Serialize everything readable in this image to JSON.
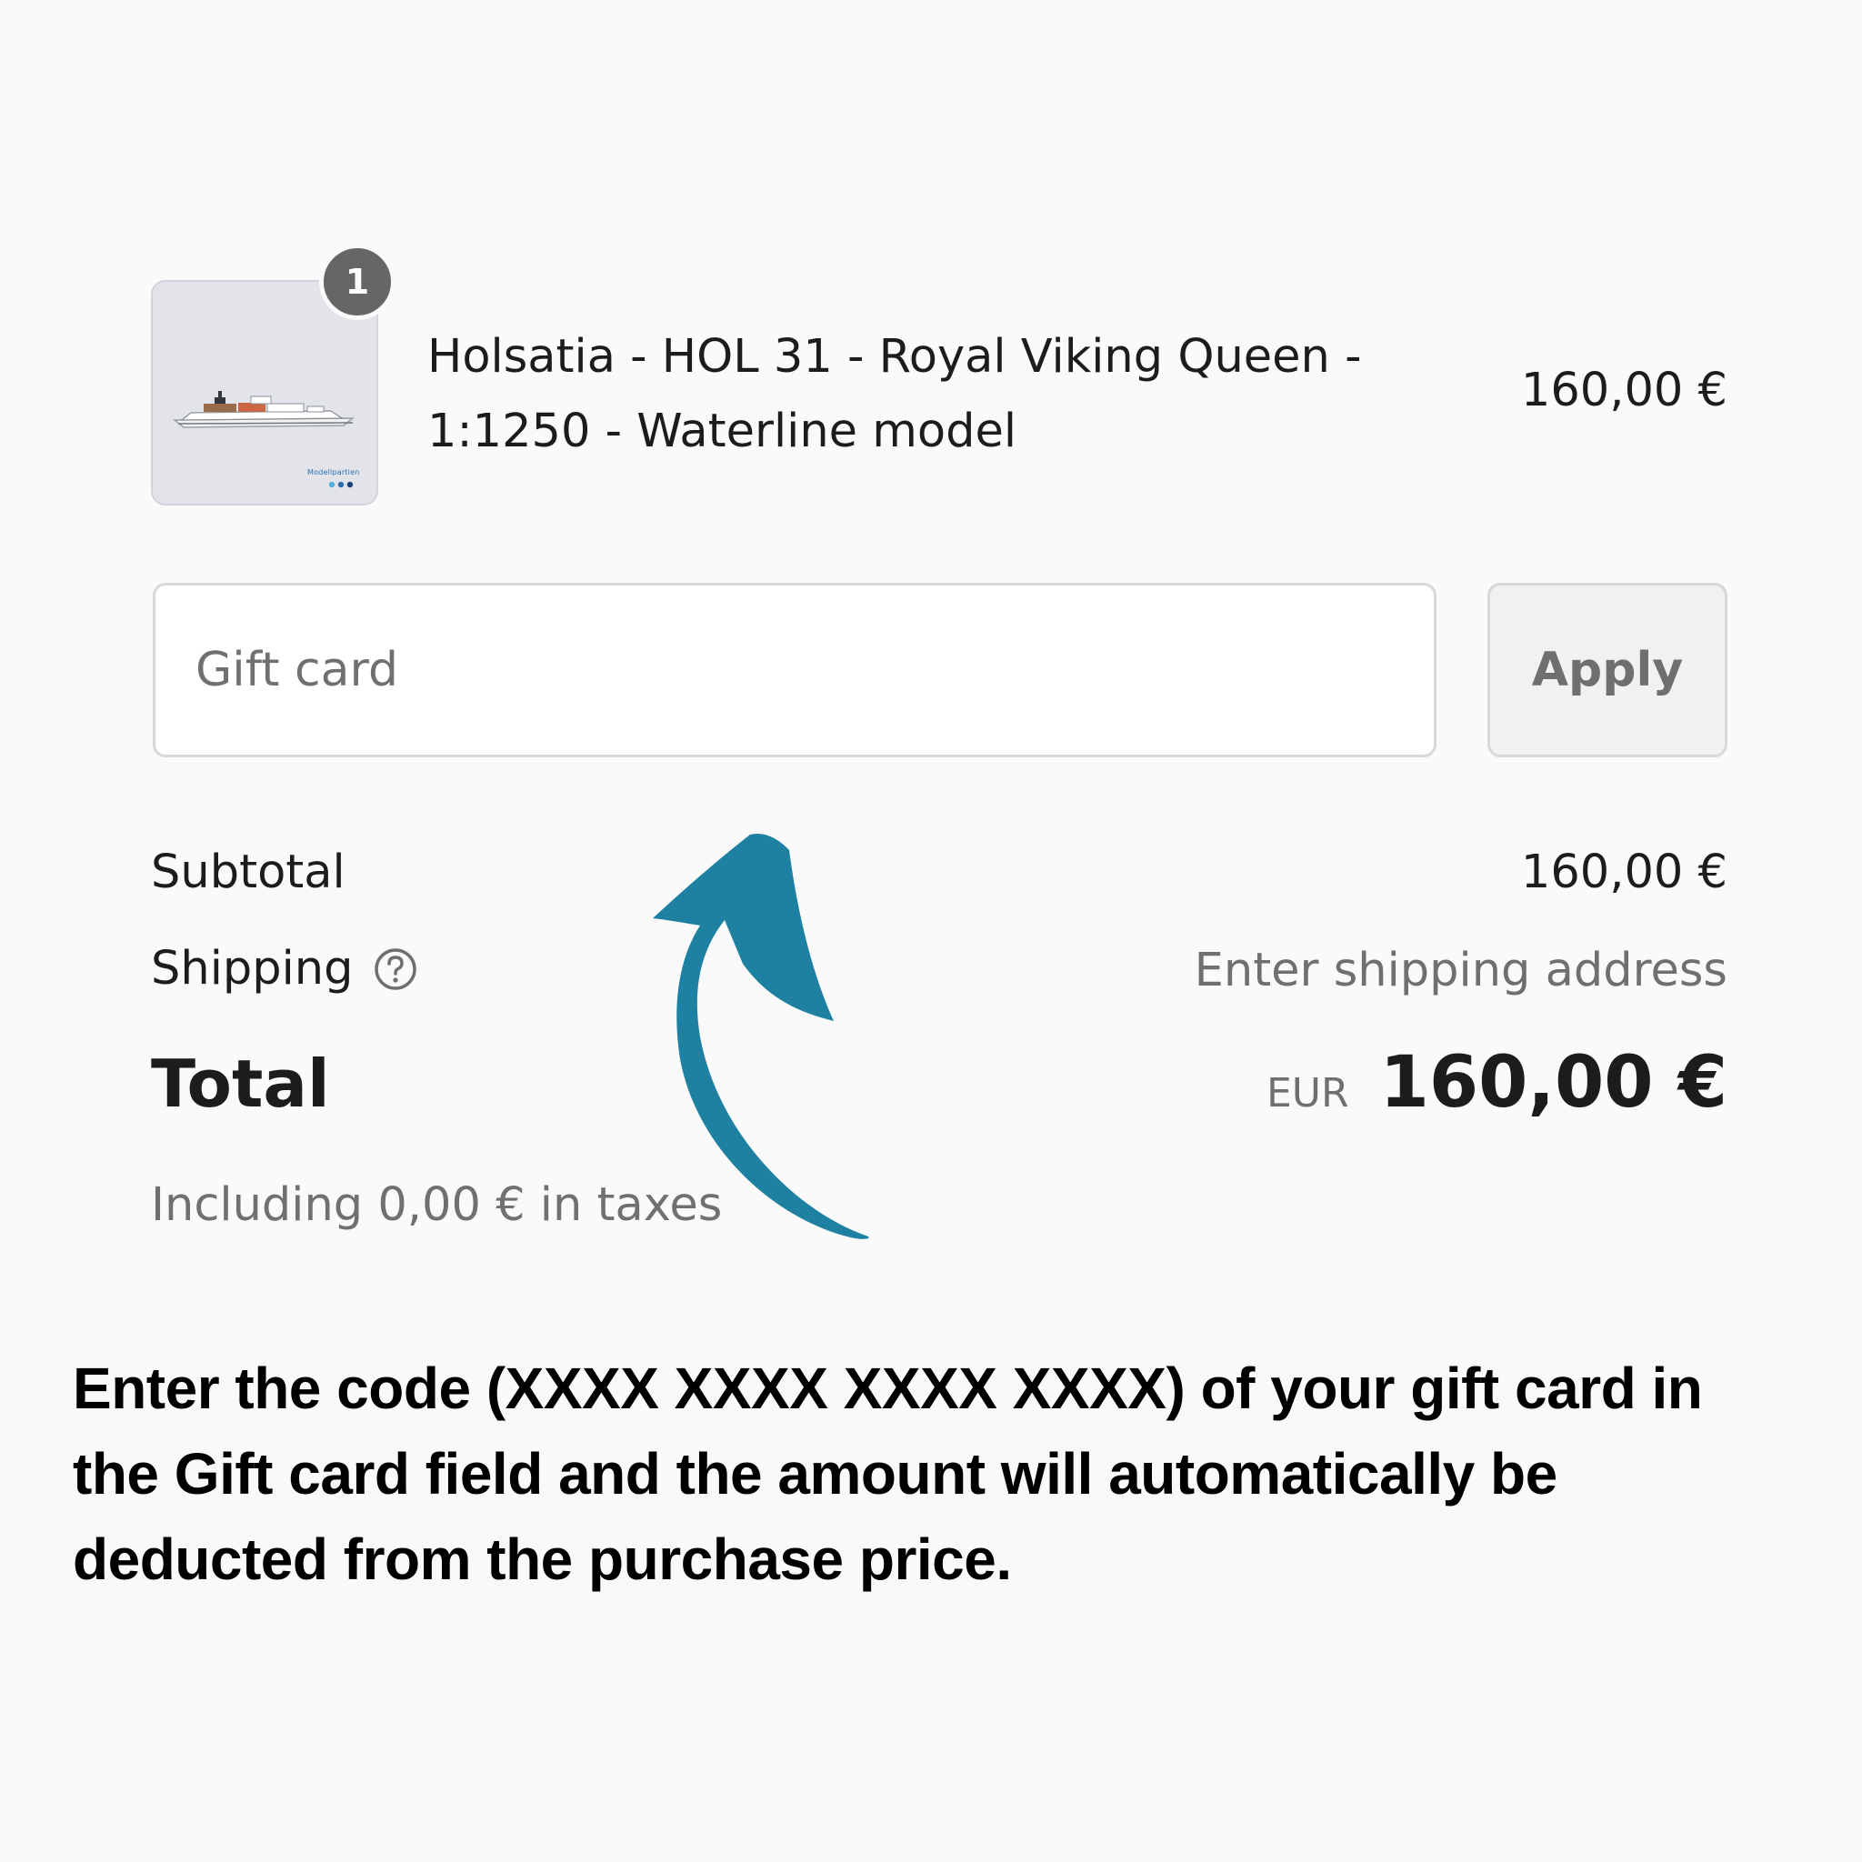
{
  "cart": {
    "item": {
      "quantity": "1",
      "title": "Holsatia - HOL 31 - Royal Viking Queen - 1:1250 - Waterline model",
      "price": "160,00 €",
      "thumbnail_logo_text": "Modellpartien"
    }
  },
  "gift_card": {
    "placeholder": "Gift card",
    "value": "",
    "apply_label": "Apply"
  },
  "summary": {
    "subtotal_label": "Subtotal",
    "subtotal_value": "160,00 €",
    "shipping_label": "Shipping",
    "shipping_help_icon": "question-circle-icon",
    "shipping_value": "Enter shipping address",
    "total_label": "Total",
    "total_currency": "EUR",
    "total_value": "160,00 €",
    "taxes_note": "Including 0,00 € in taxes"
  },
  "annotation": {
    "arrow_icon": "curved-arrow-up-icon",
    "arrow_color": "#1e81a1",
    "instruction": "Enter the code (XXXX XXXX XXXX XXXX) of your gift card in the Gift card field and the amount will automatically be deducted from the purchase price."
  }
}
